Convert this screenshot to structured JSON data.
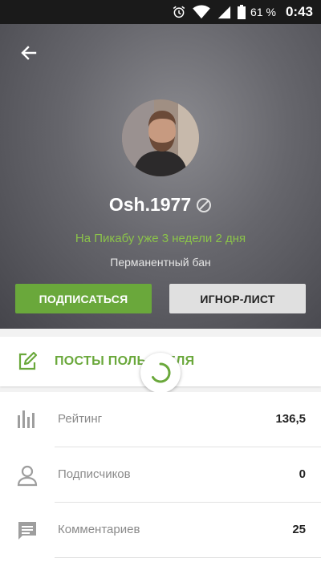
{
  "status_bar": {
    "battery": "61 %",
    "time": "0:43",
    "icons": [
      "alarm-icon",
      "wifi-icon",
      "signal-icon",
      "battery-icon"
    ]
  },
  "profile": {
    "username": "Osh.1977",
    "on_site": "На Пикабу уже 3 недели 2 дня",
    "status": "Перманентный бан"
  },
  "buttons": {
    "subscribe": "ПОДПИСАТЬСЯ",
    "ignore": "ИГНОР-ЛИСТ"
  },
  "posts_link": {
    "label": "ПОСТЫ ПОЛЬ АТЕЛЯ"
  },
  "stats": [
    {
      "icon": "bar-chart-icon",
      "label": "Рейтинг",
      "value": "136,5"
    },
    {
      "icon": "person-icon",
      "label": "Подписчиков",
      "value": "0"
    },
    {
      "icon": "comment-icon",
      "label": "Комментариев",
      "value": "25"
    }
  ],
  "colors": {
    "accent_green": "#6aa83b",
    "light_green": "#8bc34a",
    "header_gray": "#5e5e64"
  }
}
